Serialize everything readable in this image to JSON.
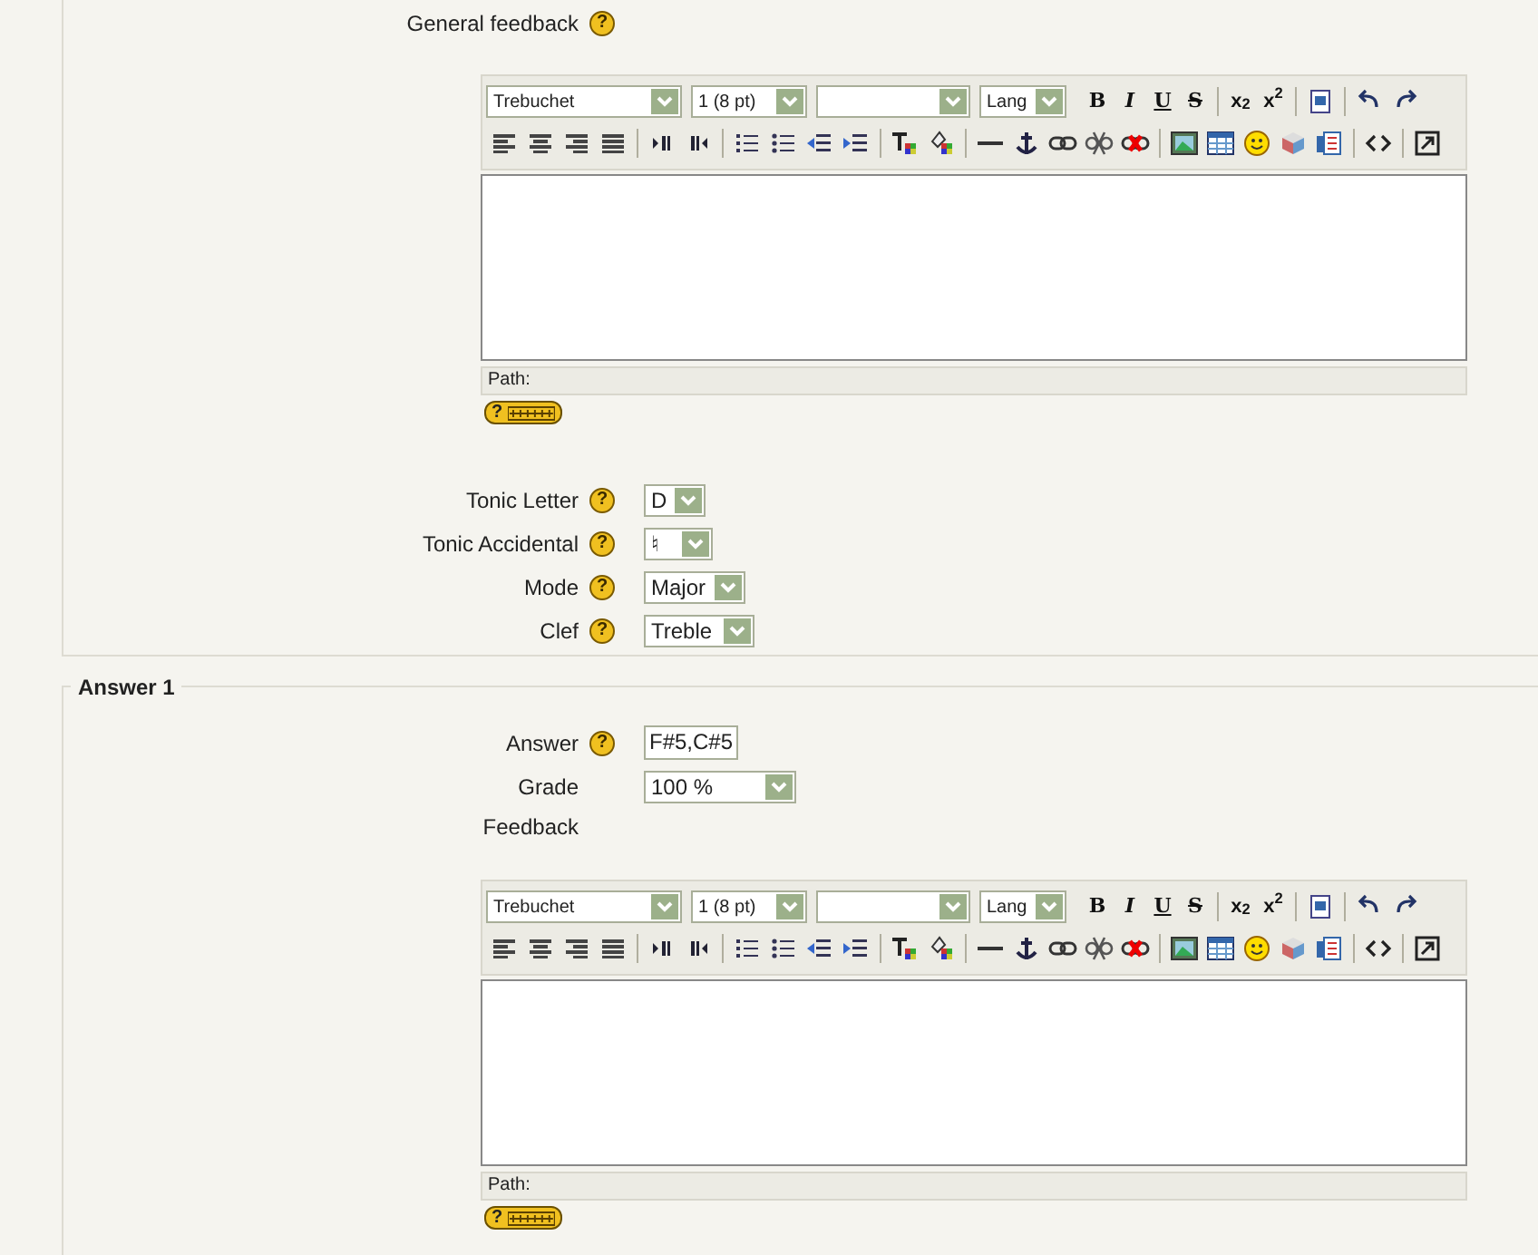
{
  "general_feedback": {
    "label": "General feedback",
    "help": "?",
    "editor": {
      "font": "Trebuchet",
      "size": "1 (8 pt)",
      "lang": "Lang",
      "text_buttons": [
        {
          "kind": "bold",
          "text": "B"
        },
        {
          "kind": "italic",
          "text": "I"
        },
        {
          "kind": "underline",
          "text": "U"
        },
        {
          "kind": "strike",
          "text": "S"
        },
        {
          "kind": "sub",
          "text": "x$_{2}$"
        },
        {
          "kind": "sup",
          "text": "x$^{2}$"
        }
      ],
      "path_label": "Path:",
      "keyboard_help": "?"
    }
  },
  "settings": [
    {
      "label": "Tonic Letter",
      "help": "?",
      "value": "D"
    },
    {
      "label": "Tonic Accidental",
      "help": "?",
      "value": "♮"
    },
    {
      "label": "Mode",
      "help": "?",
      "value": "Major"
    },
    {
      "label": "Clef",
      "help": "?",
      "value": "Treble"
    }
  ],
  "answer_section": {
    "legend": "Answer 1",
    "answer": {
      "label": "Answer",
      "help": "?",
      "value": "F#5,C#5"
    },
    "grade": {
      "label": "Grade",
      "value": "100 %"
    },
    "feedback": {
      "label": "Feedback",
      "editor": {
        "font": "Trebuchet",
        "size": "1 (8 pt)",
        "lang": "Lang",
        "text_buttons": [
          {
            "kind": "bold",
            "text": "B"
          },
          {
            "kind": "italic",
            "text": "I"
          },
          {
            "kind": "underline",
            "text": "U"
          },
          {
            "kind": "strike",
            "text": "S"
          },
          {
            "kind": "sub",
            "text": "x$_{2}$"
          },
          {
            "kind": "sup",
            "text": "x$^{2}$"
          }
        ],
        "path_label": "Path:",
        "keyboard_help": "?"
      }
    }
  }
}
